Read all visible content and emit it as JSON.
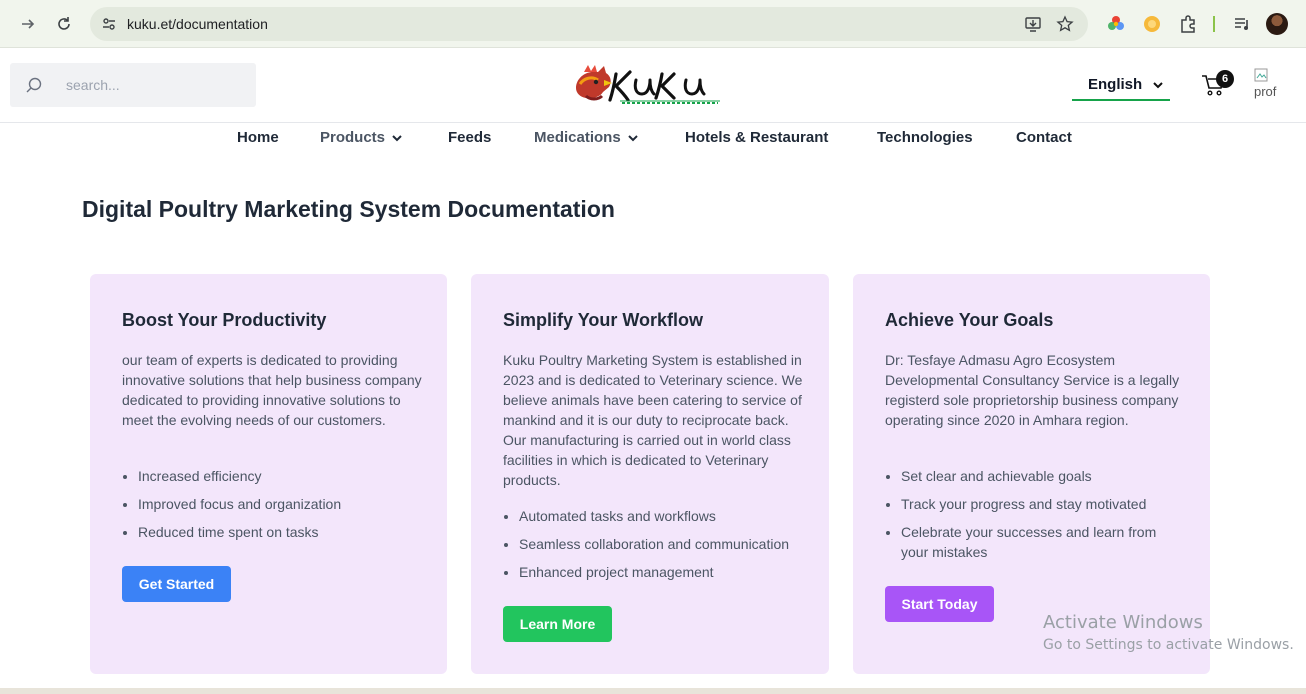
{
  "browser": {
    "url": "kuku.et/documentation"
  },
  "header": {
    "search_placeholder": "search...",
    "language": "English",
    "cart_count": "6",
    "profile_alt": "prof"
  },
  "menu": {
    "items": [
      {
        "label": "Home",
        "has_dropdown": false
      },
      {
        "label": "Products",
        "has_dropdown": true
      },
      {
        "label": "Feeds",
        "has_dropdown": false
      },
      {
        "label": "Medications",
        "has_dropdown": true
      },
      {
        "label": "Hotels & Restaurant",
        "has_dropdown": false
      },
      {
        "label": "Technologies",
        "has_dropdown": false
      },
      {
        "label": "Contact",
        "has_dropdown": false
      }
    ]
  },
  "page": {
    "title": "Digital Poultry Marketing System Documentation"
  },
  "cards": [
    {
      "title": "Boost Your Productivity",
      "body": "our team of experts is dedicated to providing innovative solutions that help business company dedicated to providing innovative solutions to meet the evolving needs of our customers.",
      "bullets": [
        "Increased efficiency",
        "Improved focus and organization",
        "Reduced time spent on tasks"
      ],
      "button": "Get Started",
      "button_color": "#3b82f6"
    },
    {
      "title": "Simplify Your Workflow",
      "body": "Kuku Poultry Marketing System is established in 2023 and is dedicated to Veterinary science. We believe animals have been catering to service of mankind and it is our duty to reciprocate back. Our manufacturing is carried out in world class facilities in which is dedicated to Veterinary products.",
      "bullets": [
        "Automated tasks and workflows",
        "Seamless collaboration and communication",
        "Enhanced project management"
      ],
      "button": "Learn More",
      "button_color": "#22c55e"
    },
    {
      "title": "Achieve Your Goals",
      "body": "Dr: Tesfaye Admasu Agro Ecosystem Developmental Consultancy Service is a legally registerd sole proprietorship business company operating since 2020 in Amhara region.",
      "bullets": [
        "Set clear and achievable goals",
        "Track your progress and stay motivated",
        "Celebrate your successes and learn from your mistakes"
      ],
      "button": "Start Today",
      "button_color": "#a855f7"
    }
  ],
  "watermark": {
    "line1": "Activate Windows",
    "line2": "Go to Settings to activate Windows."
  },
  "colors": {
    "card_bg": "#f3e6fb",
    "accent_green": "#16a34a"
  }
}
